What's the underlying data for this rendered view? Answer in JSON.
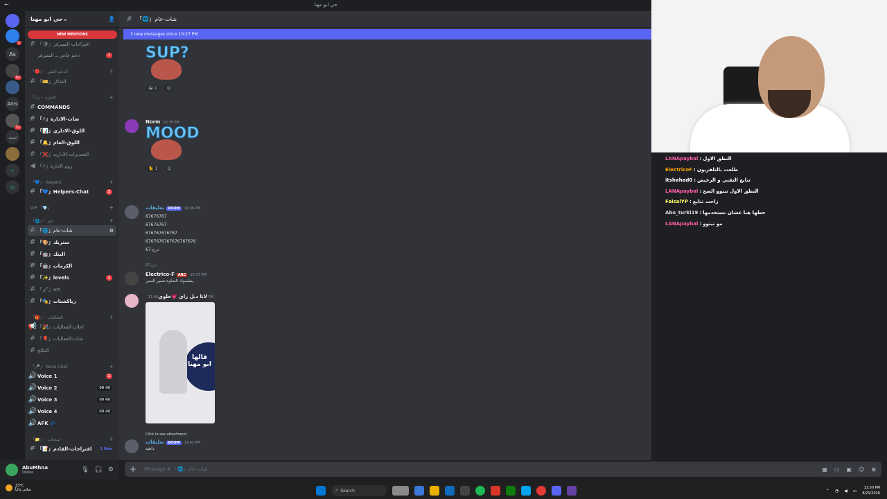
{
  "window": {
    "title": "حي ابو مهنا"
  },
  "guilds": [
    {
      "label": "",
      "badge": ""
    },
    {
      "label": "",
      "badge": "1"
    },
    {
      "label": "As",
      "badge": ""
    },
    {
      "label": "",
      "badge": "42"
    },
    {
      "label": "",
      "badge": ""
    },
    {
      "label": "Ams",
      "badge": ""
    },
    {
      "label": "",
      "badge": "11"
    },
    {
      "label": "ابوعبيد",
      "badge": ""
    },
    {
      "label": "",
      "badge": ""
    },
    {
      "label": "+",
      "badge": ""
    },
    {
      "label": "⊙",
      "badge": ""
    }
  ],
  "sidebar": {
    "server_name": "حي ابو مهنا",
    "new_mentions": "NEW MENTIONS",
    "categories": [
      {
        "label": "「🔴」・ الدعم الفني"
      },
      {
        "label": "「⚡」・ الادارة"
      },
      {
        "label": "「💙」 Helpers"
      },
      {
        "label": "VIP 「💎」"
      },
      {
        "label": "「🌐」・ عام"
      },
      {
        "label": "「🎁」・ الفعاليات"
      },
      {
        "label": "「🎤」 Voice Chat"
      },
      {
        "label": "「📁」・ سجلات"
      }
    ],
    "channels": [
      {
        "label": "「🛡」اقتراحات-السيرفر",
        "badge": ""
      },
      {
        "label": "دعم خاص بـ السيرفر",
        "badge": "1"
      },
      {
        "label": "「🎫」التذاكر",
        "badge": ""
      },
      {
        "label": "COMMANDS",
        "badge": ""
      },
      {
        "label": "「⚡」شات-الادارة",
        "badge": ""
      },
      {
        "label": "「📊」اللوق-الاداري",
        "badge": ""
      },
      {
        "label": "「🔔」اللوق-العام",
        "badge": ""
      },
      {
        "label": "「❌」التحذيرات-الاداريه",
        "badge": ""
      },
      {
        "label": "「⚡」روم الادارة",
        "badge": ""
      },
      {
        "label": "「💙」Helpers-Chat",
        "badge": "3"
      },
      {
        "label": "「🌐」شات-عام",
        "badge": ""
      },
      {
        "label": "「🎨」ستريك",
        "badge": ""
      },
      {
        "label": "「🤖」البنك",
        "badge": ""
      },
      {
        "label": "「🤖」الكرمات",
        "badge": ""
      },
      {
        "label": "「✨」levels",
        "badge": "1"
      },
      {
        "label": "「🖌」art",
        "badge": ""
      },
      {
        "label": "「🎭」رياكشنات",
        "badge": ""
      },
      {
        "label": "「🎉」اعلان-الفعاليات",
        "badge": ""
      },
      {
        "label": "「🎈」شات-الفعاليات",
        "badge": ""
      },
      {
        "label": "النتائج",
        "badge": ""
      },
      {
        "label": "Voice 1",
        "badge": "1",
        "count": ""
      },
      {
        "label": "Voice 2",
        "badge": "",
        "count": "00 40"
      },
      {
        "label": "Voice 3",
        "badge": "",
        "count": "00 40"
      },
      {
        "label": "Voice 4",
        "badge": "",
        "count": "00 40"
      },
      {
        "label": "AFK 💤",
        "badge": "",
        "count": ""
      },
      {
        "label": "「📝」اقتراحات-القادم",
        "badge": "1 New"
      }
    ]
  },
  "user": {
    "name": "AbuMhna",
    "status": "Online"
  },
  "chat": {
    "channel_name": "「🌐」شات-عام",
    "new_messages_bar": "3 new messages since 10:27 PM",
    "sticker1": "SUP?",
    "reactions1": [
      "😂 1",
      "☺"
    ],
    "msg_norm": {
      "author": "Norm",
      "time": "10:35 PM",
      "sticker": "MOOD",
      "reactions": [
        "🐈 1",
        "☺"
      ]
    },
    "msg_doom": {
      "author": "تعليقات",
      "tag": "DOOM",
      "time": "10:36 PM",
      "lines": [
        "67676767",
        "67676767",
        "676767676767",
        "6767676767676767676",
        "درج 67"
      ]
    },
    "msg_electro": {
      "reply": "درج 67",
      "author": "Electrico-F",
      "tag": "ARC",
      "time": "10:37 PM",
      "line": "يسلموك التماوه-تسير السير"
    },
    "msg_image": {
      "author": "لانا دبل راي 💗خلوي",
      "time": "11:40 PM",
      "caption": "قالها ابو مهنا"
    },
    "msg_last": {
      "reply": "Click to see attachment",
      "author": "تعليقات",
      "tag": "DOOM",
      "time": "11:42 PM",
      "line": "داهيه"
    },
    "composer_placeholder": "Message # 「🌐」شات-عام"
  },
  "twitch_chat": [
    {
      "name": "LANApaybal",
      "color": "#ff5fa8",
      "text": "النطق الاول"
    },
    {
      "name": "ElectricoF",
      "color": "#ffa500",
      "text": "طلعت بالتلفزيون"
    },
    {
      "name": "itshahad0",
      "color": "#ffffff",
      "text": "تتابع التقني و الرخيص"
    },
    {
      "name": "LANApaybal",
      "color": "#ff5fa8",
      "text": "النطق الاول تيتوو الصح"
    },
    {
      "name": "FaisalYP",
      "color": "#ffff66",
      "text": "زاحت تتابع"
    },
    {
      "name": "Abo_turki19",
      "color": "#dddddd",
      "text": "حطها هنا عشان نستخدمها"
    },
    {
      "name": "LANApaybal",
      "color": "#ff5fa8",
      "text": "مو تيتوو"
    }
  ],
  "taskbar": {
    "weather_temp": "33°C",
    "weather_desc": "صافي غالباً",
    "search_label": "Search",
    "time": "11:50 PM",
    "date": "8/21/2026"
  },
  "colors": {
    "accent": "#5865f2",
    "mention": "#da373c",
    "background": "#313338"
  }
}
